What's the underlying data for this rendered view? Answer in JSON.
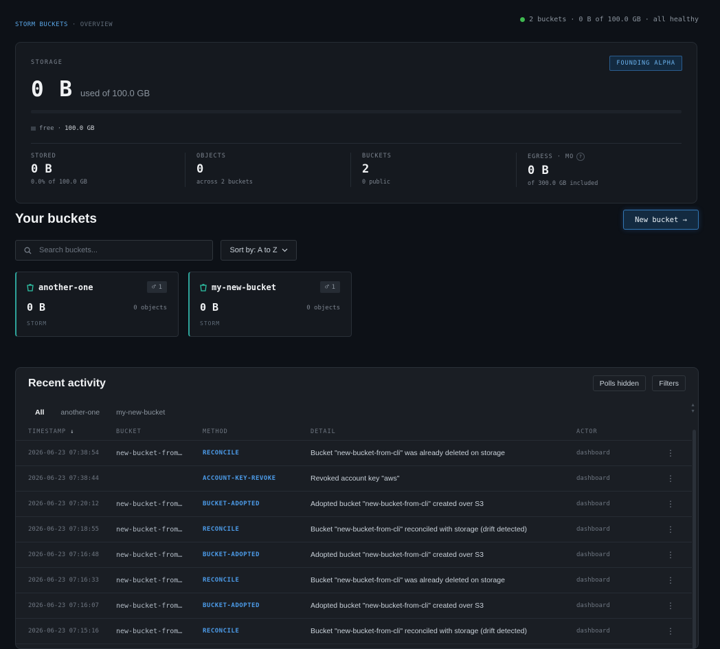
{
  "header": {
    "brand": "STORM BUCKETS",
    "separator": "·",
    "page": "OVERVIEW",
    "status_text": "2 buckets · 0 B of 100.0 GB · all healthy",
    "status_color": "#3fb950"
  },
  "storage": {
    "label": "STORAGE",
    "badge": "FOUNDING ALPHA",
    "used_value": "0 B",
    "used_of": "used of 100.0 GB",
    "used_fraction": 0,
    "free_label": "free",
    "free_sep": "·",
    "free_value": "100.0 GB",
    "stats": [
      {
        "label": "STORED",
        "value": "0 B",
        "sub": "0.0% of 100.0 GB"
      },
      {
        "label": "OBJECTS",
        "value": "0",
        "sub": "across 2 buckets"
      },
      {
        "label": "BUCKETS",
        "value": "2",
        "sub": "0 public"
      },
      {
        "label": "EGRESS · MO",
        "value": "0 B",
        "sub": "of 300.0 GB included",
        "help": "?"
      }
    ]
  },
  "buckets": {
    "title": "Your buckets",
    "new_button": "New bucket →",
    "search_placeholder": "Search buckets...",
    "sort_label": "Sort by: A to Z",
    "items": [
      {
        "name": "another-one",
        "keys": "1",
        "size": "0 B",
        "objects": "0 objects",
        "tag": "STORM"
      },
      {
        "name": "my-new-bucket",
        "keys": "1",
        "size": "0 B",
        "objects": "0 objects",
        "tag": "STORM"
      }
    ]
  },
  "activity": {
    "title": "Recent activity",
    "polls_button": "Polls hidden",
    "filters_button": "Filters",
    "tabs": [
      "All",
      "another-one",
      "my-new-bucket"
    ],
    "columns": {
      "timestamp": "TIMESTAMP",
      "bucket": "BUCKET",
      "method": "METHOD",
      "detail": "DETAIL",
      "actor": "ACTOR"
    },
    "rows": [
      {
        "ts": "2026-06-23 07:38:54",
        "bucket": "new-bucket-from…",
        "method": "RECONCILE",
        "detail": "Bucket \"new-bucket-from-cli\" was already deleted on storage",
        "actor": "dashboard"
      },
      {
        "ts": "2026-06-23 07:38:44",
        "bucket": "",
        "method": "ACCOUNT-KEY-REVOKE",
        "detail": "Revoked account key \"aws\"",
        "actor": "dashboard"
      },
      {
        "ts": "2026-06-23 07:20:12",
        "bucket": "new-bucket-from…",
        "method": "BUCKET-ADOPTED",
        "detail": "Adopted bucket \"new-bucket-from-cli\" created over S3",
        "actor": "dashboard"
      },
      {
        "ts": "2026-06-23 07:18:55",
        "bucket": "new-bucket-from…",
        "method": "RECONCILE",
        "detail": "Bucket \"new-bucket-from-cli\" reconciled with storage (drift detected)",
        "actor": "dashboard"
      },
      {
        "ts": "2026-06-23 07:16:48",
        "bucket": "new-bucket-from…",
        "method": "BUCKET-ADOPTED",
        "detail": "Adopted bucket \"new-bucket-from-cli\" created over S3",
        "actor": "dashboard"
      },
      {
        "ts": "2026-06-23 07:16:33",
        "bucket": "new-bucket-from…",
        "method": "RECONCILE",
        "detail": "Bucket \"new-bucket-from-cli\" was already deleted on storage",
        "actor": "dashboard"
      },
      {
        "ts": "2026-06-23 07:16:07",
        "bucket": "new-bucket-from…",
        "method": "BUCKET-ADOPTED",
        "detail": "Adopted bucket \"new-bucket-from-cli\" created over S3",
        "actor": "dashboard"
      },
      {
        "ts": "2026-06-23 07:15:16",
        "bucket": "new-bucket-from…",
        "method": "RECONCILE",
        "detail": "Bucket \"new-bucket-from-cli\" reconciled with storage (drift detected)",
        "actor": "dashboard"
      }
    ]
  },
  "icons": {
    "status": "status-dot-icon",
    "search": "search-icon",
    "sort": "chevron-down-icon",
    "bucket": "bucket-icon",
    "key": "key-icon",
    "sort_dir": "arrow-down-icon",
    "row_menu": "kebab-menu-icon"
  }
}
